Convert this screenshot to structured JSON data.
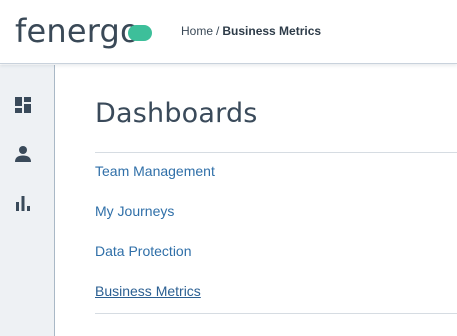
{
  "header": {
    "logo_text": "fenergo",
    "breadcrumb": {
      "home": "Home",
      "separator": "/",
      "current": "Business Metrics"
    }
  },
  "sidebar": {
    "items": [
      {
        "icon": "dashboard-icon"
      },
      {
        "icon": "person-icon"
      },
      {
        "icon": "bar-chart-icon"
      }
    ]
  },
  "main": {
    "title": "Dashboards",
    "links": [
      {
        "label": "Team Management"
      },
      {
        "label": "My Journeys"
      },
      {
        "label": "Data Protection"
      },
      {
        "label": "Business Metrics",
        "active": true
      }
    ]
  },
  "colors": {
    "brand_green": "#3dbf9a",
    "text_dark": "#3a4957",
    "link_blue": "#2f6fa8",
    "sidebar_bg": "#eef1f4"
  }
}
